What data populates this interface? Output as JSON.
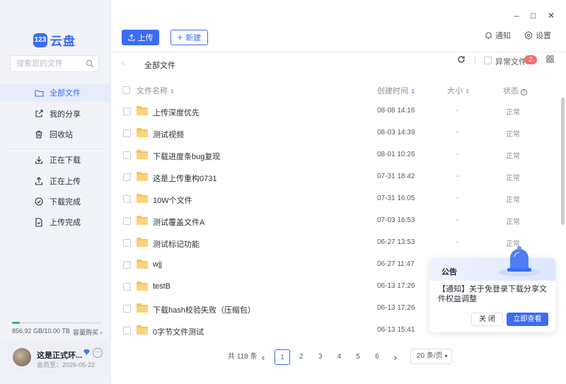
{
  "app": {
    "logo_badge": "123",
    "logo_text": "云盘"
  },
  "window_controls": {
    "minimize": "–",
    "maximize": "□",
    "close": "✕"
  },
  "sidebar": {
    "search_placeholder": "搜索您的文件",
    "items": [
      {
        "label": "全部文件",
        "icon": "folder-icon",
        "active": true
      },
      {
        "label": "我的分享",
        "icon": "share-icon"
      },
      {
        "label": "回收站",
        "icon": "trash-icon"
      },
      {
        "label": "正在下载",
        "icon": "download-icon"
      },
      {
        "label": "正在上传",
        "icon": "upload-icon"
      },
      {
        "label": "下载完成",
        "icon": "check-circle-icon"
      },
      {
        "label": "上传完成",
        "icon": "file-check-icon"
      }
    ],
    "storage": {
      "text": "856.92 GB/10.00 TB",
      "used_fraction": 0.0857,
      "buy": "容量购买"
    },
    "user": {
      "name": "这是正式环...",
      "member": "会员至：2026-05-22",
      "more": "···"
    }
  },
  "toolbar": {
    "upload_label": "上传",
    "new_label": "新建",
    "notify_label": "通知",
    "settings_label": "设置"
  },
  "breadcrumb": {
    "current": "全部文件"
  },
  "abnormal": {
    "label": "异常文件",
    "count": "2"
  },
  "table": {
    "headers": {
      "name": "文件名称",
      "time": "创建时间",
      "size": "大小",
      "status": "状态"
    },
    "rows": [
      {
        "name": "上传深度优先",
        "time": "08-08 14:16",
        "size": "-",
        "status": "正常"
      },
      {
        "name": "测试视频",
        "time": "08-03 14:39",
        "size": "-",
        "status": "正常"
      },
      {
        "name": "下载进度条bug复现",
        "time": "08-01 10:26",
        "size": "-",
        "status": "正常"
      },
      {
        "name": "这是上传重构0731",
        "time": "07-31 18:42",
        "size": "-",
        "status": "正常"
      },
      {
        "name": "10W个文件",
        "time": "07-31 16:05",
        "size": "-",
        "status": "正常"
      },
      {
        "name": "测试覆盖文件A",
        "time": "07-03 16:53",
        "size": "-",
        "status": "正常"
      },
      {
        "name": "测试标记功能",
        "time": "06-27 13:53",
        "size": "-",
        "status": "正常"
      },
      {
        "name": "wjj",
        "time": "06-27 11:47",
        "size": "",
        "status": ""
      },
      {
        "name": "testB",
        "time": "06-13 17:26",
        "size": "",
        "status": ""
      },
      {
        "name": "下载hash校验失败（压缩包）",
        "time": "06-13 17:26",
        "size": "",
        "status": ""
      },
      {
        "name": "0字节文件测试",
        "time": "06-13 15:41",
        "size": "",
        "status": ""
      }
    ]
  },
  "pagination": {
    "total": "共 118 条",
    "prev": "‹",
    "next": "›",
    "pages": [
      "1",
      "2",
      "3",
      "4",
      "5",
      "6"
    ],
    "current": "1",
    "page_size": "20 条/页"
  },
  "notice": {
    "title": "公告",
    "text": "【通知】关于免登录下载分享文件权益调整",
    "close_label": "关 闭",
    "view_label": "立即查看"
  },
  "colors": {
    "accent": "#3b6cf5",
    "folder": "#f7c35a",
    "badge": "#f0706a",
    "storage": "#2bb673"
  }
}
